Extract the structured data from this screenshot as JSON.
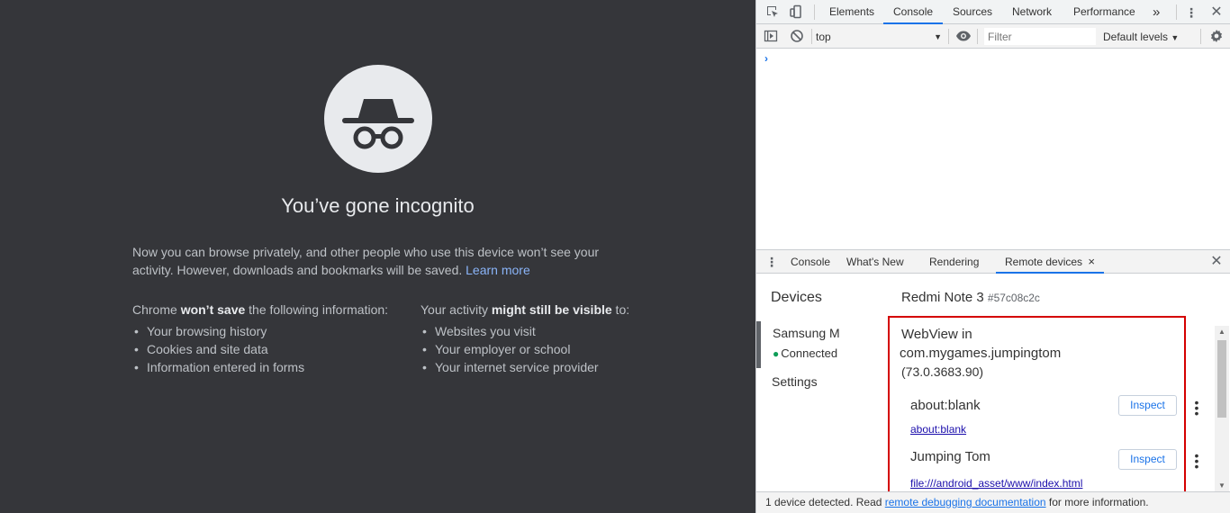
{
  "incognito": {
    "title": "You’ve gone incognito",
    "intro_text": "Now you can browse privately, and other people who use this device won’t see your activity. However, downloads and bookmarks will be saved.",
    "learn_more": "Learn more",
    "left_heading_pre": "Chrome ",
    "left_heading_bold": "won’t save",
    "left_heading_post": " the following information:",
    "left_items": [
      "Your browsing history",
      "Cookies and site data",
      "Information entered in forms"
    ],
    "right_heading_pre": "Your activity ",
    "right_heading_bold": "might still be visible",
    "right_heading_post": " to:",
    "right_items": [
      "Websites you visit",
      "Your employer or school",
      "Your internet service provider"
    ]
  },
  "devtools": {
    "tabs": {
      "elements": "Elements",
      "console": "Console",
      "sources": "Sources",
      "network": "Network",
      "performance": "Performance",
      "more": "»"
    },
    "console_bar": {
      "context": "top",
      "filter_placeholder": "Filter",
      "levels": "Default levels"
    },
    "prompt": "›",
    "drawer_tabs": {
      "console": "Console",
      "whats_new": "What's New",
      "rendering": "Rendering",
      "remote_devices": "Remote devices",
      "close": "×"
    },
    "remote": {
      "devices_heading": "Devices",
      "device_label": "Samsung M",
      "device_status": "Connected",
      "settings_label": "Settings",
      "device_name": "Redmi Note 3",
      "device_serial": "#57c08c2c",
      "webview_title": "WebView in",
      "webview_package": "com.mygames.jumpingtom",
      "webview_version": "(73.0.3683.90)",
      "pages": [
        {
          "title": "about:blank",
          "url": "about:blank",
          "button": "Inspect"
        },
        {
          "title": "Jumping Tom",
          "url": "file:///android_asset/www/index.html",
          "button": "Inspect"
        }
      ]
    },
    "status": {
      "pre": "1 device detected. Read ",
      "link": "remote debugging documentation",
      "post": " for more information."
    }
  }
}
